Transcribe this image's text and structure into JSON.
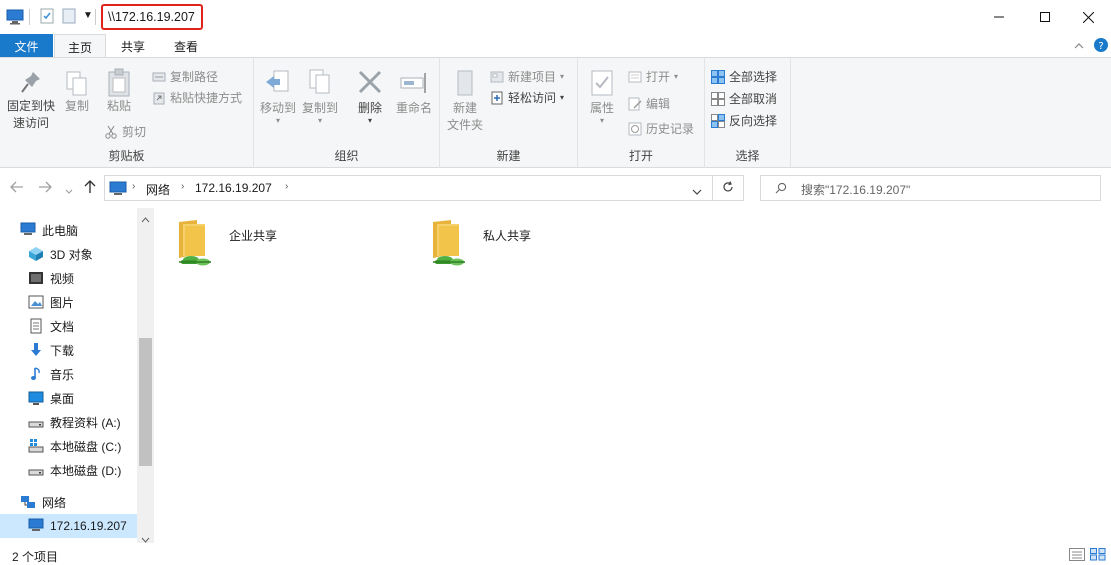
{
  "window": {
    "title_path": "\\\\172.16.19.207",
    "minimize_glyph": "—",
    "maximize_glyph": "☐",
    "close_glyph": "✕"
  },
  "ribbon_tabs": [
    "文件",
    "主页",
    "共享",
    "查看"
  ],
  "ribbon": {
    "clipboard": {
      "pin_line1": "固定到快",
      "pin_line2": "速访问",
      "copy": "复制",
      "paste": "粘贴",
      "copy_path": "复制路径",
      "paste_shortcut": "粘贴快捷方式",
      "cut": "剪切",
      "group": "剪贴板"
    },
    "organize": {
      "move_to": "移动到",
      "copy_to": "复制到",
      "delete": "删除",
      "rename": "重命名",
      "group": "组织"
    },
    "new": {
      "new_folder_line1": "新建",
      "new_folder_line2": "文件夹",
      "new_item": "新建项目",
      "easy_access": "轻松访问",
      "group": "新建"
    },
    "open": {
      "properties": "属性",
      "open": "打开",
      "edit": "编辑",
      "history": "历史记录",
      "group": "打开"
    },
    "select": {
      "select_all": "全部选择",
      "select_none": "全部取消",
      "invert": "反向选择",
      "group": "选择"
    }
  },
  "address": {
    "crumbs": [
      "网络",
      "172.16.19.207"
    ],
    "search_placeholder": "搜索\"172.16.19.207\""
  },
  "nav_pane": {
    "items": [
      {
        "label": "此电脑",
        "icon": "computer-icon"
      },
      {
        "label": "3D 对象",
        "icon": "3d-objects-icon"
      },
      {
        "label": "视频",
        "icon": "video-icon"
      },
      {
        "label": "图片",
        "icon": "pictures-icon"
      },
      {
        "label": "文档",
        "icon": "documents-icon"
      },
      {
        "label": "下载",
        "icon": "downloads-icon"
      },
      {
        "label": "音乐",
        "icon": "music-icon"
      },
      {
        "label": "桌面",
        "icon": "desktop-icon"
      },
      {
        "label": "教程资料 (A:)",
        "icon": "drive-icon"
      },
      {
        "label": "本地磁盘 (C:)",
        "icon": "windows-drive-icon"
      },
      {
        "label": "本地磁盘 (D:)",
        "icon": "drive-icon"
      },
      {
        "label": "网络",
        "icon": "network-icon"
      },
      {
        "label": "172.16.19.207",
        "icon": "computer-icon"
      }
    ]
  },
  "content": {
    "items": [
      {
        "label": "企业共享",
        "icon": "shared-folder-icon"
      },
      {
        "label": "私人共享",
        "icon": "shared-folder-icon"
      }
    ]
  },
  "status": {
    "count": "2 个项目"
  },
  "colors": {
    "file_tab": "#1979ca",
    "highlight_box": "#e0241b",
    "selected_nav": "#cce8ff",
    "folder": "#f3c44a"
  }
}
